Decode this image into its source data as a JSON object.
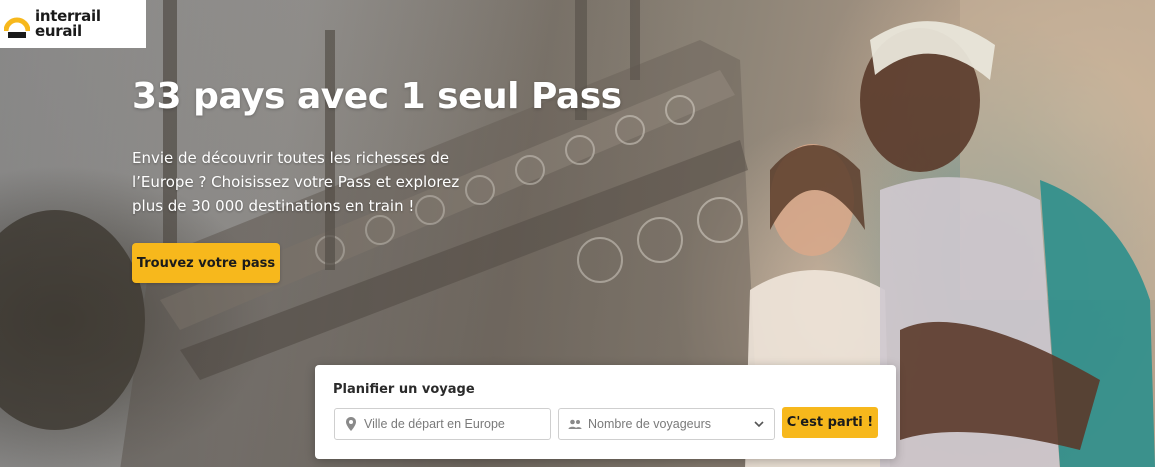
{
  "brand": {
    "line1": "interrail",
    "line2": "eurail",
    "color": "#f7b81c"
  },
  "hero": {
    "headline": "33 pays avec 1 seul Pass",
    "subtext": "Envie de découvrir toutes les richesses de l’Europe ? Choisissez votre Pass et explorez plus de 30 000 destinations en train !",
    "cta_label": "Trouvez votre pass"
  },
  "planner": {
    "title": "Planifier un voyage",
    "origin_placeholder": "Ville de départ en Europe",
    "origin_icon": "location-pin-icon",
    "travelers_value": "Nombre de voyageurs",
    "travelers_icon": "people-icon",
    "dropdown_icon": "chevron-down-icon",
    "submit_label": "C'est parti !"
  },
  "colors": {
    "accent": "#f7b81c",
    "panel": "#ffffff",
    "text_dark": "#2a2a2a"
  }
}
